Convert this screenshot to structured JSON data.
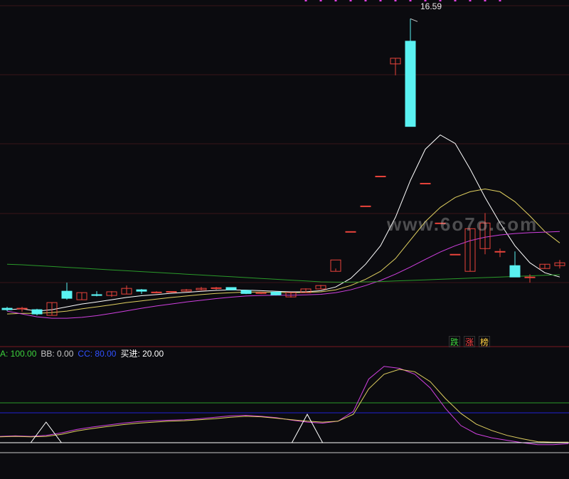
{
  "colors": {
    "background": "#0b0b0f",
    "up_candle": "#e8433b",
    "down_candle": "#5af2f2",
    "ma_white": "#ffffff",
    "ma_yellow": "#e0d060",
    "ma_magenta": "#d040e0",
    "ma_green": "#2a9a2a",
    "grid_red": "#3a1418",
    "signal_magenta": "#e040e0"
  },
  "main_chart": {
    "high_label": "16.59",
    "signal_tags": [
      {
        "label": "跌",
        "color": "#3cd23c"
      },
      {
        "label": "涨",
        "color": "#ff4040"
      },
      {
        "label": "榜",
        "color": "#ffd040"
      }
    ],
    "watermark": "www.6o7o.com"
  },
  "indicator": {
    "legend": [
      {
        "label": "A: 100.00",
        "color": "#3cd23c"
      },
      {
        "label": "BB: 0.00",
        "color": "#c8c8c8"
      },
      {
        "label": "CC: 80.00",
        "color": "#3050ff"
      },
      {
        "label": "买进: 20.00",
        "color": "#ffffff"
      }
    ]
  },
  "chart_data": [
    {
      "type": "candlestick",
      "candles": [
        {
          "o": 6.4,
          "h": 6.45,
          "l": 6.3,
          "c": 6.35
        },
        {
          "o": 6.38,
          "h": 6.45,
          "l": 6.28,
          "c": 6.4
        },
        {
          "o": 6.35,
          "h": 6.38,
          "l": 6.15,
          "c": 6.2
        },
        {
          "o": 6.15,
          "h": 6.6,
          "l": 6.15,
          "c": 6.6
        },
        {
          "o": 7.0,
          "h": 7.3,
          "l": 6.7,
          "c": 6.75
        },
        {
          "o": 6.7,
          "h": 6.95,
          "l": 6.7,
          "c": 6.95
        },
        {
          "o": 6.88,
          "h": 7.0,
          "l": 6.82,
          "c": 6.85
        },
        {
          "o": 6.85,
          "h": 7.0,
          "l": 6.8,
          "c": 6.98
        },
        {
          "o": 6.9,
          "h": 7.2,
          "l": 6.9,
          "c": 7.1
        },
        {
          "o": 7.05,
          "h": 7.08,
          "l": 6.9,
          "c": 7.0
        },
        {
          "o": 6.95,
          "h": 7.0,
          "l": 6.93,
          "c": 6.97
        },
        {
          "o": 6.97,
          "h": 7.0,
          "l": 6.95,
          "c": 6.99
        },
        {
          "o": 7.0,
          "h": 7.08,
          "l": 7.0,
          "c": 7.05
        },
        {
          "o": 7.05,
          "h": 7.15,
          "l": 7.03,
          "c": 7.1
        },
        {
          "o": 7.1,
          "h": 7.15,
          "l": 7.05,
          "c": 7.12
        },
        {
          "o": 7.13,
          "h": 7.13,
          "l": 7.03,
          "c": 7.05
        },
        {
          "o": 7.03,
          "h": 7.03,
          "l": 6.9,
          "c": 6.92
        },
        {
          "o": 6.92,
          "h": 6.98,
          "l": 6.9,
          "c": 6.95
        },
        {
          "o": 6.97,
          "h": 6.97,
          "l": 6.85,
          "c": 6.87
        },
        {
          "o": 6.8,
          "h": 6.97,
          "l": 6.78,
          "c": 6.95
        },
        {
          "o": 6.95,
          "h": 7.1,
          "l": 6.95,
          "c": 7.08
        },
        {
          "o": 7.08,
          "h": 7.22,
          "l": 7.08,
          "c": 7.2
        },
        {
          "o": 7.7,
          "h": 7.8,
          "l": 7.7,
          "c": 8.1
        },
        {
          "o": 9.1,
          "h": 9.1,
          "l": 9.1,
          "c": 9.1
        },
        {
          "o": 10.0,
          "h": 10.0,
          "l": 10.0,
          "c": 10.0
        },
        {
          "o": 11.05,
          "h": 11.05,
          "l": 11.05,
          "c": 11.05
        },
        {
          "o": 15.0,
          "h": 15.2,
          "l": 14.6,
          "c": 15.2
        },
        {
          "o": 15.8,
          "h": 16.59,
          "l": 12.8,
          "c": 12.8
        },
        {
          "o": 10.8,
          "h": 10.8,
          "l": 10.8,
          "c": 10.8
        },
        {
          "o": 9.4,
          "h": 9.4,
          "l": 9.4,
          "c": 9.4
        },
        {
          "o": 8.3,
          "h": 8.3,
          "l": 8.3,
          "c": 8.3
        },
        {
          "o": 7.7,
          "h": 9.2,
          "l": 7.7,
          "c": 9.2
        },
        {
          "o": 8.5,
          "h": 9.75,
          "l": 8.3,
          "c": 9.4
        },
        {
          "o": 8.4,
          "h": 8.5,
          "l": 8.2,
          "c": 8.4
        },
        {
          "o": 7.9,
          "h": 8.4,
          "l": 7.5,
          "c": 7.5
        },
        {
          "o": 7.5,
          "h": 7.6,
          "l": 7.3,
          "c": 7.5
        },
        {
          "o": 7.8,
          "h": 7.95,
          "l": 7.8,
          "c": 7.95
        },
        {
          "o": 7.9,
          "h": 8.1,
          "l": 7.8,
          "c": 8.0
        }
      ],
      "moving_averages": [
        {
          "color": "white",
          "values": [
            6.35,
            6.38,
            6.3,
            6.35,
            6.45,
            6.55,
            6.62,
            6.7,
            6.78,
            6.84,
            6.88,
            6.93,
            6.96,
            7.0,
            7.03,
            7.05,
            7.04,
            7.02,
            7.0,
            6.98,
            6.98,
            7.02,
            7.15,
            7.45,
            7.95,
            8.6,
            9.6,
            10.9,
            12.0,
            12.5,
            12.2,
            11.3,
            10.3,
            9.4,
            8.6,
            8.0,
            7.65,
            7.5
          ]
        },
        {
          "color": "yellow",
          "values": [
            6.2,
            6.22,
            6.22,
            6.25,
            6.3,
            6.38,
            6.45,
            6.52,
            6.6,
            6.66,
            6.72,
            6.78,
            6.83,
            6.88,
            6.92,
            6.95,
            6.97,
            6.97,
            6.96,
            6.95,
            6.96,
            6.98,
            7.05,
            7.2,
            7.42,
            7.7,
            8.15,
            8.8,
            9.45,
            9.95,
            10.3,
            10.5,
            10.6,
            10.5,
            10.15,
            9.65,
            9.1,
            8.7
          ]
        },
        {
          "color": "magenta",
          "values": [
            6.3,
            6.2,
            6.1,
            6.05,
            6.05,
            6.08,
            6.14,
            6.22,
            6.31,
            6.4,
            6.48,
            6.55,
            6.62,
            6.68,
            6.74,
            6.79,
            6.83,
            6.85,
            6.86,
            6.86,
            6.87,
            6.89,
            6.95,
            7.05,
            7.2,
            7.38,
            7.6,
            7.85,
            8.12,
            8.38,
            8.6,
            8.78,
            8.9,
            8.98,
            9.03,
            9.06,
            9.08,
            9.1
          ]
        },
        {
          "color": "green",
          "values": [
            7.95,
            7.93,
            7.9,
            7.87,
            7.84,
            7.81,
            7.78,
            7.75,
            7.72,
            7.69,
            7.66,
            7.63,
            7.6,
            7.57,
            7.54,
            7.51,
            7.48,
            7.45,
            7.42,
            7.39,
            7.36,
            7.33,
            7.32,
            7.32,
            7.33,
            7.34,
            7.36,
            7.38,
            7.4,
            7.42,
            7.44,
            7.46,
            7.48,
            7.5,
            7.52,
            7.54,
            7.56,
            7.58
          ]
        }
      ]
    },
    {
      "type": "line",
      "ylim": [
        0,
        100
      ],
      "reference_lines": [
        {
          "label": "A",
          "value": 100
        },
        {
          "label": "CC",
          "value": 80
        },
        {
          "label": "买进",
          "value": 20
        },
        {
          "label": "BB",
          "value": 0
        }
      ],
      "series": [
        {
          "color": "magenta",
          "values": [
            33,
            34,
            33,
            35,
            40,
            47,
            52,
            56,
            60,
            63,
            65,
            66,
            67,
            69,
            72,
            75,
            76,
            74,
            71,
            66,
            62,
            60,
            64,
            84,
            150,
            176,
            172,
            160,
            132,
            90,
            55,
            38,
            30,
            25,
            20,
            16,
            16,
            18
          ]
        },
        {
          "color": "yellow",
          "values": [
            32,
            33,
            32,
            33,
            37,
            44,
            49,
            53,
            57,
            60,
            62,
            64,
            65,
            67,
            69,
            72,
            74,
            73,
            70,
            67,
            64,
            62,
            64,
            78,
            130,
            160,
            170,
            165,
            145,
            110,
            80,
            58,
            45,
            35,
            28,
            22,
            21,
            21
          ]
        },
        {
          "color": "white",
          "values": [
            20,
            20,
            20,
            62,
            20,
            20,
            20,
            20,
            20,
            20,
            20,
            20,
            20,
            20,
            20,
            20,
            20,
            20,
            20,
            20,
            78,
            20,
            20,
            20,
            20,
            20,
            20,
            20,
            20,
            20,
            20,
            20,
            20,
            20,
            20,
            20,
            20,
            20
          ]
        }
      ]
    }
  ]
}
